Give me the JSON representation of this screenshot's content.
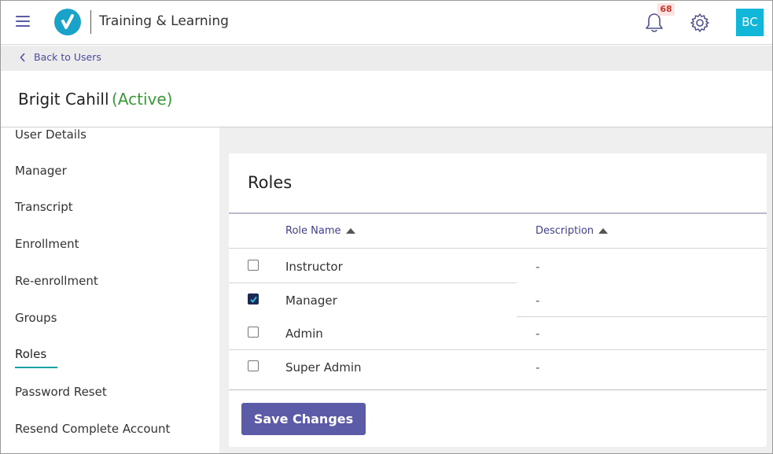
{
  "header": {
    "app_title": "Training & Learning",
    "notification_count": "68",
    "avatar_initials": "BC",
    "brand_color": "#1aa3c9"
  },
  "breadcrumb": {
    "back_label": "Back to Users"
  },
  "user": {
    "name": "Brigit Cahill",
    "status": "(Active)",
    "status_color": "#3a9a3a"
  },
  "sidebar": {
    "items": [
      {
        "label": "User Details"
      },
      {
        "label": "Manager"
      },
      {
        "label": "Transcript"
      },
      {
        "label": "Enrollment"
      },
      {
        "label": "Re-enrollment"
      },
      {
        "label": "Groups"
      },
      {
        "label": "Roles",
        "active": true
      },
      {
        "label": "Password Reset"
      },
      {
        "label": "Resend Complete Account"
      }
    ]
  },
  "roles_panel": {
    "title": "Roles",
    "columns": [
      "Role Name",
      "Description"
    ],
    "rows": [
      {
        "name": "Instructor",
        "description": "-",
        "checked": false
      },
      {
        "name": "Manager",
        "description": "-",
        "checked": true
      },
      {
        "name": "Admin",
        "description": "-",
        "checked": false
      },
      {
        "name": "Super Admin",
        "description": "-",
        "checked": false
      }
    ],
    "save_label": "Save Changes",
    "accent_color": "#5b5ba8"
  }
}
